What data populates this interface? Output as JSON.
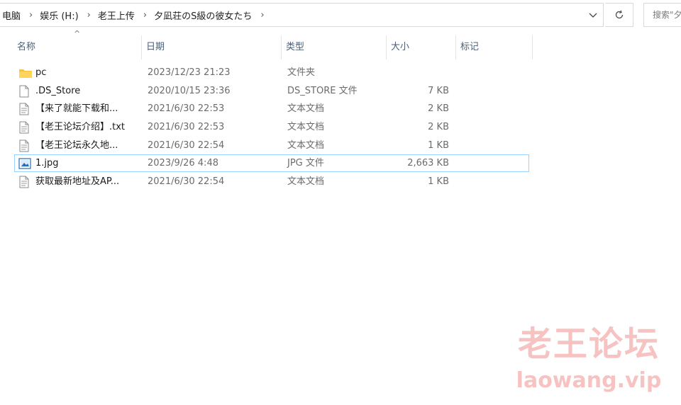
{
  "breadcrumb": [
    "电脑",
    "娱乐 (H:)",
    "老王上传",
    "夕凪荘のS級の彼女たち"
  ],
  "search": {
    "placeholder": "搜索\"夕"
  },
  "columns": {
    "name": "名称",
    "date": "日期",
    "type": "类型",
    "size": "大小",
    "tags": "标记"
  },
  "files": [
    {
      "name": "pc",
      "date": "2023/12/23 21:23",
      "type": "文件夹",
      "size": "",
      "icon": "folder-icon"
    },
    {
      "name": ".DS_Store",
      "date": "2020/10/15 23:36",
      "type": "DS_STORE 文件",
      "size": "7 KB",
      "icon": "file-icon"
    },
    {
      "name": "【来了就能下载和...",
      "date": "2021/6/30 22:53",
      "type": "文本文档",
      "size": "2 KB",
      "icon": "text-file-icon"
    },
    {
      "name": "【老王论坛介绍】.txt",
      "date": "2021/6/30 22:53",
      "type": "文本文档",
      "size": "2 KB",
      "icon": "text-file-icon"
    },
    {
      "name": "【老王论坛永久地...",
      "date": "2021/6/30 22:54",
      "type": "文本文档",
      "size": "1 KB",
      "icon": "text-file-icon"
    },
    {
      "name": "1.jpg",
      "date": "2023/9/26 4:48",
      "type": "JPG 文件",
      "size": "2,663 KB",
      "icon": "image-file-icon"
    },
    {
      "name": "获取最新地址及AP...",
      "date": "2021/6/30 22:54",
      "type": "文本文档",
      "size": "1 KB",
      "icon": "text-file-icon"
    }
  ],
  "watermark": {
    "text_cn": "老王论坛",
    "text_en": "laowang.vip"
  },
  "colors": {
    "folder": "#f5c342",
    "selection_border": "#99d1ff",
    "header_text": "#4c607a",
    "watermark": "#f3b0ae"
  }
}
